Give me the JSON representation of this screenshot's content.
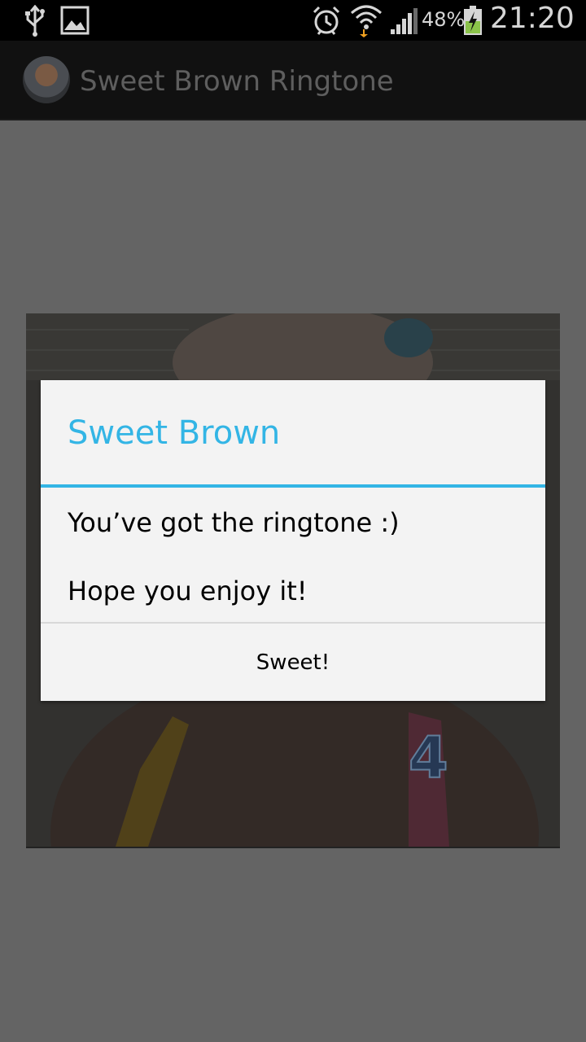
{
  "status_bar": {
    "battery_percent": "48%",
    "time": "21:20",
    "icons": [
      "usb-icon",
      "gallery-icon",
      "alarm-icon",
      "wifi-icon",
      "signal-icon",
      "battery-charging-icon"
    ]
  },
  "action_bar": {
    "title": "Sweet Brown Ringtone",
    "avatar_icon": "app-avatar"
  },
  "dialog": {
    "title": "Sweet Brown",
    "message_line1": "You’ve got the ringtone :)",
    "message_line2": "Hope you enjoy it!",
    "button_label": "Sweet!",
    "accent_color": "#33b5e5"
  }
}
